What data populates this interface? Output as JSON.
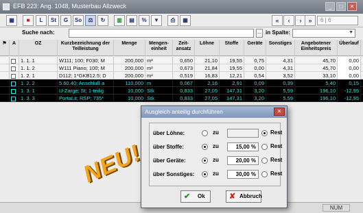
{
  "window": {
    "title": "EFB 223: Ang. 1048, Musterbau Allzweck"
  },
  "toolbar": {
    "buttons": [
      {
        "name": "table-icon",
        "glyph": "▦"
      },
      {
        "name": "red-stop-icon",
        "glyph": "■"
      },
      {
        "name": "letter-l-icon",
        "glyph": "L"
      },
      {
        "name": "letter-st-icon",
        "glyph": "St"
      },
      {
        "name": "letter-g-icon",
        "glyph": "G"
      },
      {
        "name": "letter-so-icon",
        "glyph": "So"
      },
      {
        "name": "scale-icon",
        "glyph": "⚖"
      },
      {
        "name": "refresh-icon",
        "glyph": "↻"
      },
      {
        "name": "calc-icon",
        "glyph": "▥"
      },
      {
        "name": "chart-icon",
        "glyph": "▤"
      },
      {
        "name": "percent-icon",
        "glyph": "%"
      },
      {
        "name": "filter-icon",
        "glyph": "▼"
      },
      {
        "name": "print-icon",
        "glyph": "⎙"
      },
      {
        "name": "grid-icon",
        "glyph": "▦"
      }
    ],
    "nav": [
      "«",
      "‹",
      "›",
      "»"
    ],
    "page_indicator": "6 | 6"
  },
  "search": {
    "label": "Suche nach:",
    "value": "",
    "ellipsis": "...",
    "in_label": "in Spalte:",
    "column_value": ""
  },
  "table": {
    "headers": {
      "a": "A",
      "oz": "OZ",
      "kurz": "Kurzbezeichnung der Teilleistung",
      "menge": "Menge",
      "einheit": "Mengen-einheit",
      "zeit": "Zeit-ansatz",
      "loehne": "Löhne",
      "stoffe": "Stoffe",
      "geraete": "Geräte",
      "sonstiges": "Sonstiges",
      "preis": "Angebotener Einheitspreis",
      "ueberlauf": "Überlauf"
    },
    "rows": [
      {
        "oz": "1. 1.  1",
        "kurz": "W111; 100; F030; M",
        "menge": "200,000",
        "einheit": "m²",
        "zeit": "0,650",
        "loehne": "21,10",
        "stoffe": "19,55",
        "geraete": "0,75",
        "sonstiges": "4,31",
        "preis": "45,70",
        "ueberlauf": "0,00",
        "highlight": false
      },
      {
        "oz": "1. 1.  2",
        "kurz": "W111 Piano; 100; M",
        "menge": "200,000",
        "einheit": "m²",
        "zeit": "0,673",
        "loehne": "21,84",
        "stoffe": "19,55",
        "geraete": "0,00",
        "sonstiges": "4,31",
        "preis": "45,70",
        "ueberlauf": "0,00",
        "highlight": false
      },
      {
        "oz": "1. 2.  1",
        "kurz": "D112; 1*GKB12.5; D",
        "menge": "200,000",
        "einheit": "m²",
        "zeit": "0,519",
        "loehne": "16,83",
        "stoffe": "12,21",
        "geraete": "0,54",
        "sonstiges": "3,52",
        "preis": "33,10",
        "ueberlauf": "0,00",
        "highlight": false
      },
      {
        "oz": "1. 2.  2",
        "kurz": "5.60.40; Anschluß a",
        "menge": "110,000",
        "einheit": "m",
        "zeit": "0,067",
        "loehne": "2,16",
        "stoffe": "2,91",
        "geraete": "0,09",
        "sonstiges": "0,39",
        "preis": "5,40",
        "ueberlauf": "0,15",
        "highlight": true
      },
      {
        "oz": "1. 3.  1",
        "kurz": "U-Zarge; St; 1-teilig",
        "menge": "10,000",
        "einheit": "Stk",
        "zeit": "0,833",
        "loehne": "27,05",
        "stoffe": "147,31",
        "geraete": "3,20",
        "sonstiges": "5,59",
        "preis": "196,10",
        "ueberlauf": "-12,95",
        "highlight": true
      },
      {
        "oz": "1. 3.  3",
        "kurz": "PortaLit; RSP; 735*",
        "menge": "10,000",
        "einheit": "Stk",
        "zeit": "0,833",
        "loehne": "27,05",
        "stoffe": "147,31",
        "geraete": "3,20",
        "sonstiges": "5,59",
        "preis": "196,10",
        "ueberlauf": "-12,95",
        "highlight": true
      }
    ]
  },
  "dialog": {
    "title": "Ausgleich anteilig durchführen",
    "close": "✕",
    "rows": [
      {
        "label": "über Löhne:",
        "zu_label": "zu",
        "value": "",
        "rest_label": "Rest",
        "zu_selected": false,
        "rest_selected": true
      },
      {
        "label": "über Stoffe:",
        "zu_label": "zu",
        "value": "15,00 %",
        "rest_label": "Rest",
        "zu_selected": true,
        "rest_selected": false
      },
      {
        "label": "über Geräte:",
        "zu_label": "zu",
        "value": "20,00 %",
        "rest_label": "Rest",
        "zu_selected": true,
        "rest_selected": false
      },
      {
        "label": "über Sonstiges:",
        "zu_label": "zu",
        "value": "30,00 %",
        "rest_label": "Rest",
        "zu_selected": true,
        "rest_selected": false
      }
    ],
    "ok_label": "Ok",
    "cancel_label": "Abbruch"
  },
  "overlay": {
    "stamp_text": "NEU!"
  },
  "status": {
    "num": "NUM"
  }
}
